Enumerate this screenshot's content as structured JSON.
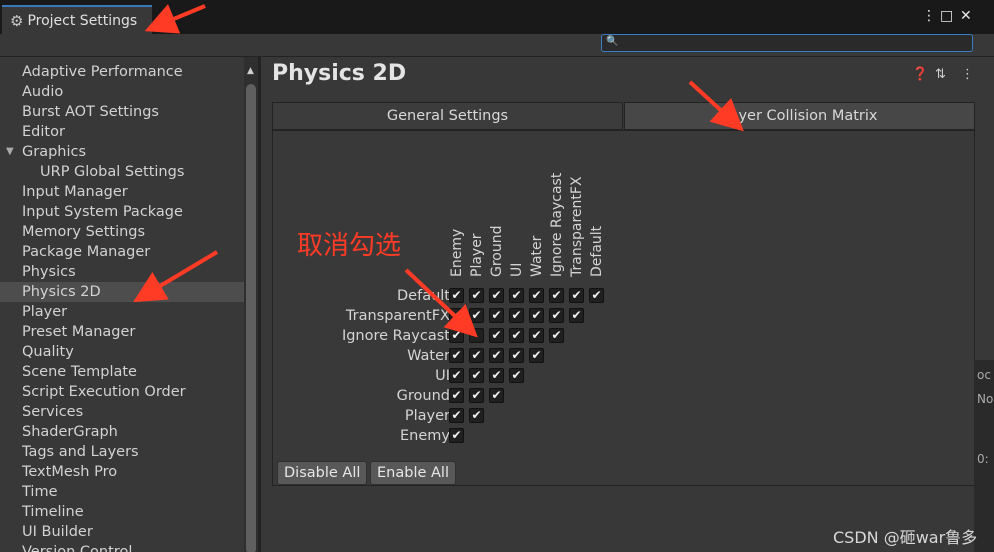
{
  "window": {
    "title": "Project Settings",
    "controls": {
      "menu": "⋮",
      "maximize": "□",
      "close": "✕"
    }
  },
  "search": {
    "value": "",
    "placeholder": ""
  },
  "sidebar": {
    "items": [
      {
        "label": "Adaptive Performance",
        "indent": 0
      },
      {
        "label": "Audio",
        "indent": 0
      },
      {
        "label": "Burst AOT Settings",
        "indent": 0
      },
      {
        "label": "Editor",
        "indent": 0
      },
      {
        "label": "Graphics",
        "indent": 0,
        "expanded": true
      },
      {
        "label": "URP Global Settings",
        "indent": 1
      },
      {
        "label": "Input Manager",
        "indent": 0
      },
      {
        "label": "Input System Package",
        "indent": 0
      },
      {
        "label": "Memory Settings",
        "indent": 0
      },
      {
        "label": "Package Manager",
        "indent": 0
      },
      {
        "label": "Physics",
        "indent": 0
      },
      {
        "label": "Physics 2D",
        "indent": 0,
        "selected": true
      },
      {
        "label": "Player",
        "indent": 0
      },
      {
        "label": "Preset Manager",
        "indent": 0
      },
      {
        "label": "Quality",
        "indent": 0
      },
      {
        "label": "Scene Template",
        "indent": 0
      },
      {
        "label": "Script Execution Order",
        "indent": 0
      },
      {
        "label": "Services",
        "indent": 0
      },
      {
        "label": "ShaderGraph",
        "indent": 0
      },
      {
        "label": "Tags and Layers",
        "indent": 0
      },
      {
        "label": "TextMesh Pro",
        "indent": 0
      },
      {
        "label": "Time",
        "indent": 0
      },
      {
        "label": "Timeline",
        "indent": 0
      },
      {
        "label": "UI Builder",
        "indent": 0
      },
      {
        "label": "Version Control",
        "indent": 0
      }
    ]
  },
  "main": {
    "title": "Physics 2D",
    "tabs": [
      {
        "label": "General Settings",
        "active": false
      },
      {
        "label": "Layer Collision Matrix",
        "active": true
      }
    ],
    "matrix": {
      "columns": [
        "Enemy",
        "Player",
        "Ground",
        "UI",
        "Water",
        "Ignore Raycast",
        "TransparentFX",
        "Default"
      ],
      "rows": [
        {
          "label": "Default",
          "checks": [
            true,
            true,
            true,
            true,
            true,
            true,
            true,
            true
          ]
        },
        {
          "label": "TransparentFX",
          "checks": [
            true,
            true,
            true,
            true,
            true,
            true,
            true
          ]
        },
        {
          "label": "Ignore Raycast",
          "checks": [
            true,
            false,
            true,
            true,
            true,
            true
          ]
        },
        {
          "label": "Water",
          "checks": [
            true,
            true,
            true,
            true,
            true
          ]
        },
        {
          "label": "UI",
          "checks": [
            true,
            true,
            true,
            true
          ]
        },
        {
          "label": "Ground",
          "checks": [
            true,
            true,
            true
          ]
        },
        {
          "label": "Player",
          "checks": [
            true,
            true
          ]
        },
        {
          "label": "Enemy",
          "checks": [
            true
          ]
        }
      ]
    },
    "buttons": {
      "disable_all": "Disable All",
      "enable_all": "Enable All"
    }
  },
  "annotation": {
    "text": "取消勾选",
    "color": "#ff3b26"
  },
  "watermark": "CSDN @砸war鲁多",
  "colors": {
    "accent": "#3a79bb",
    "annotation_red": "#ff3b26",
    "selected_row": "#4d4d4d"
  }
}
